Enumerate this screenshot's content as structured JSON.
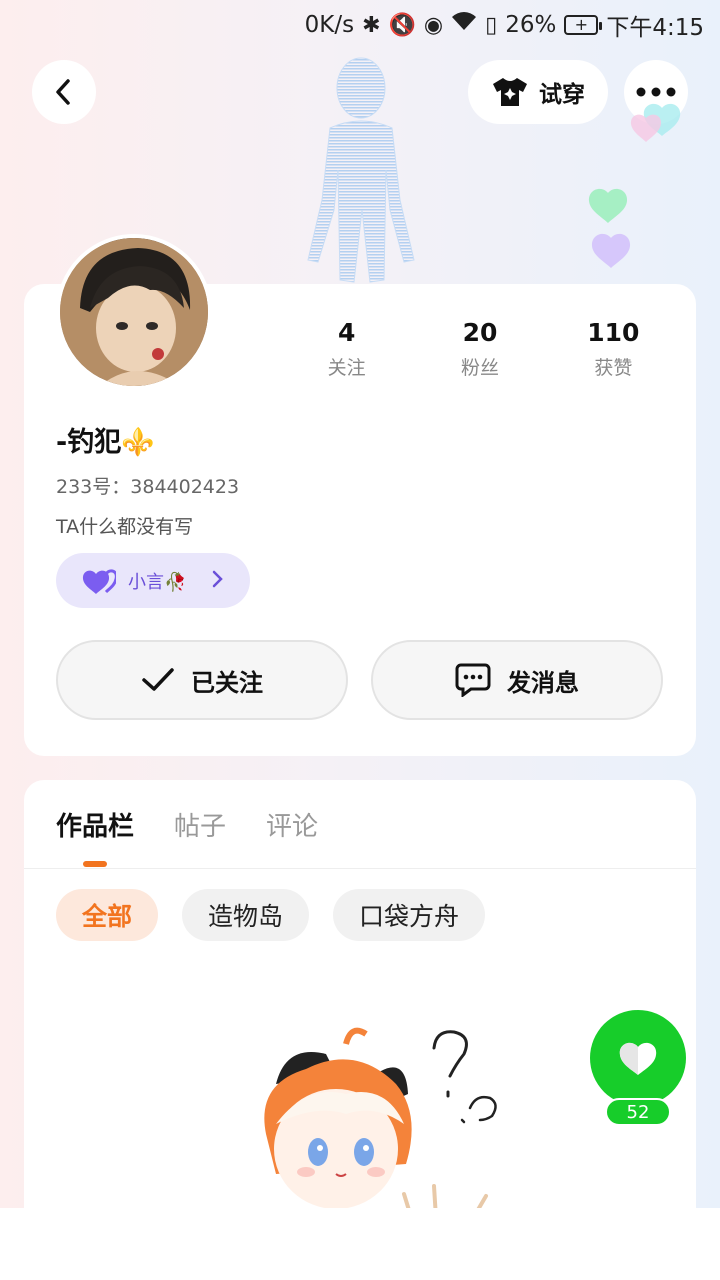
{
  "status_bar": {
    "net_speed": "0K/s",
    "battery": "26%",
    "time": "下午4:15"
  },
  "header": {
    "back_icon": "chevron-left-icon",
    "try_on_label": "试穿",
    "more_icon": "more-horizontal-icon"
  },
  "profile": {
    "stats": [
      {
        "value": "4",
        "label": "关注"
      },
      {
        "value": "20",
        "label": "粉丝"
      },
      {
        "value": "110",
        "label": "获赞"
      }
    ],
    "name": "-钓犯⚜️",
    "id_line": "233号：384402423",
    "bio": "TA什么都没有写",
    "tag": "小言🥀",
    "follow_label": "已关注",
    "message_label": "发消息"
  },
  "works": {
    "tabs": [
      "作品栏",
      "帖子",
      "评论"
    ],
    "filters": [
      "全部",
      "造物岛",
      "口袋方舟"
    ]
  },
  "like": {
    "count": "52",
    "color": "#17cd2a"
  },
  "colors": {
    "accent": "#f2741f",
    "tag_purple": "#6a4fd8"
  }
}
